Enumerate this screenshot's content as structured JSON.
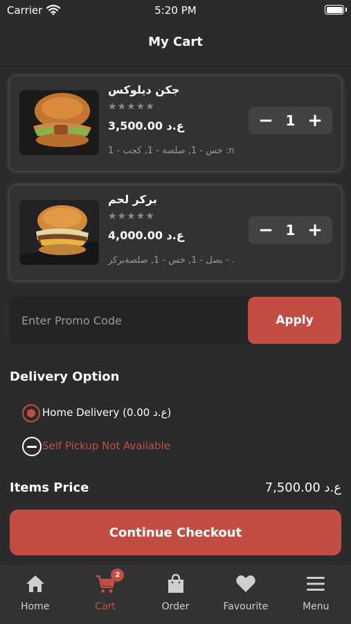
{
  "status_bar": {
    "carrier": "Carrier",
    "time": "5:20 PM"
  },
  "nav": {
    "title": "My Cart"
  },
  "cart_items": [
    {
      "name": "جكن ديلوكس",
      "stars": "★★★★★",
      "price": "ع.د 3,500.00",
      "addons": "خس - 1,  صلصة - 1,  كجب - 1 :n",
      "quantity": "1"
    },
    {
      "name": "بركر لحم",
      "stars": "★★★★★",
      "price": "ع.د 4,000.00",
      "addons": "بصل - 1,  خس - 1,  صلصةبركر - .",
      "quantity": "1"
    }
  ],
  "stepper": {
    "minus": "−",
    "plus": "+"
  },
  "promo": {
    "placeholder": "Enter Promo Code",
    "apply_label": "Apply"
  },
  "delivery": {
    "title": "Delivery Option",
    "home_label": "Home Delivery  (ع.د 0.00)",
    "pickup_label": "Self Pickup Not Available"
  },
  "totals": {
    "label": "Items Price",
    "value": "ع.د 7,500.00"
  },
  "checkout": {
    "label": "Continue Checkout"
  },
  "tabs": [
    {
      "label": "Home",
      "icon": "home-icon"
    },
    {
      "label": "Cart",
      "icon": "cart-icon",
      "badge": "2"
    },
    {
      "label": "Order",
      "icon": "bag-icon"
    },
    {
      "label": "Favourite",
      "icon": "heart-icon"
    },
    {
      "label": "Menu",
      "icon": "menu-icon"
    }
  ],
  "colors": {
    "accent": "#c24e43",
    "background": "#2b2b2b",
    "card": "#323232"
  }
}
